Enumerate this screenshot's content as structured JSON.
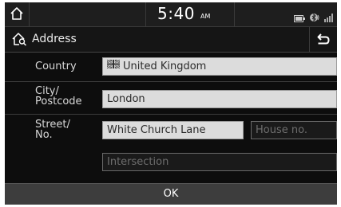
{
  "status": {
    "time": "5:40",
    "ampm": "AM"
  },
  "header": {
    "title": "Address"
  },
  "form": {
    "country_label": "Country",
    "country_value": "United Kingdom",
    "city_label_line1": "City/",
    "city_label_line2": "Postcode",
    "city_value": "London",
    "street_label_line1": "Street/",
    "street_label_line2": "No.",
    "street_value": "White Church Lane",
    "house_placeholder": "House no.",
    "intersection_placeholder": "Intersection"
  },
  "footer": {
    "ok_label": "OK"
  },
  "colors": {
    "screen_background": "#0d0d0d",
    "field_background": "#dcdcdc",
    "ok_bar": "#3d3d3d"
  },
  "icons": [
    "home-icon",
    "navigation-home-icon",
    "back-icon",
    "battery-icon",
    "bluetooth-icon",
    "signal-icon",
    "uk-flag-icon"
  ]
}
